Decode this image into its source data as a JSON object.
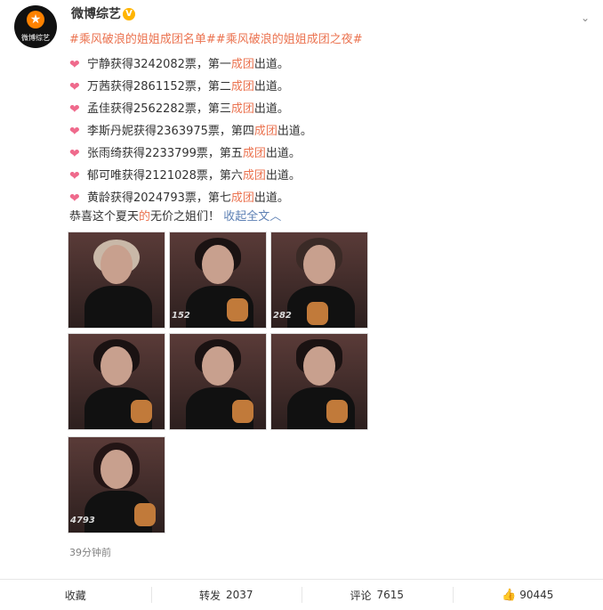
{
  "account": {
    "name": "微博综艺",
    "avatar_text": "微博综艺",
    "verified_badge": "V"
  },
  "post": {
    "hashtag_1": "#乘风破浪的姐姐成团名单#",
    "hashtag_2": "#乘风破浪的姐姐成团之夜#",
    "lines": [
      {
        "pre": "宁静获得3242082票，第一",
        "red": "成团",
        "post": "出道。"
      },
      {
        "pre": "万茜获得2861152票，第二",
        "red": "成团",
        "post": "出道。"
      },
      {
        "pre": "孟佳获得2562282票，第三",
        "red": "成团",
        "post": "出道。"
      },
      {
        "pre": "李斯丹妮获得2363975票，第四",
        "red": "成团",
        "post": "出道。"
      },
      {
        "pre": "张雨绮获得2233799票，第五",
        "red": "成团",
        "post": "出道。"
      },
      {
        "pre": "郁可唯获得2121028票，第六",
        "red": "成团",
        "post": "出道。"
      },
      {
        "pre": "黄龄获得2024793票，第七",
        "red": "成团",
        "post": "出道。"
      }
    ],
    "final_pre": "恭喜这个夏天",
    "final_red": "的",
    "final_post": "无价之姐们！",
    "collapse_label": "收起全文",
    "photo_labels": [
      "",
      "152",
      "282",
      "",
      "",
      "",
      "4793"
    ],
    "timestamp": "39分钟前"
  },
  "actions": {
    "favorite": "收藏",
    "repost_label": "转发",
    "repost_count": "2037",
    "comment_label": "评论",
    "comment_count": "7615",
    "like_count": "90445"
  },
  "icons": {
    "heart": "heart-emoji-icon",
    "more": "chevron-down-icon",
    "like": "thumbs-up-icon",
    "collapse": "chevron-up-icon"
  },
  "colors": {
    "accent": "#eb7350",
    "link": "#5d80b4",
    "brand_orange": "#ff8200"
  }
}
